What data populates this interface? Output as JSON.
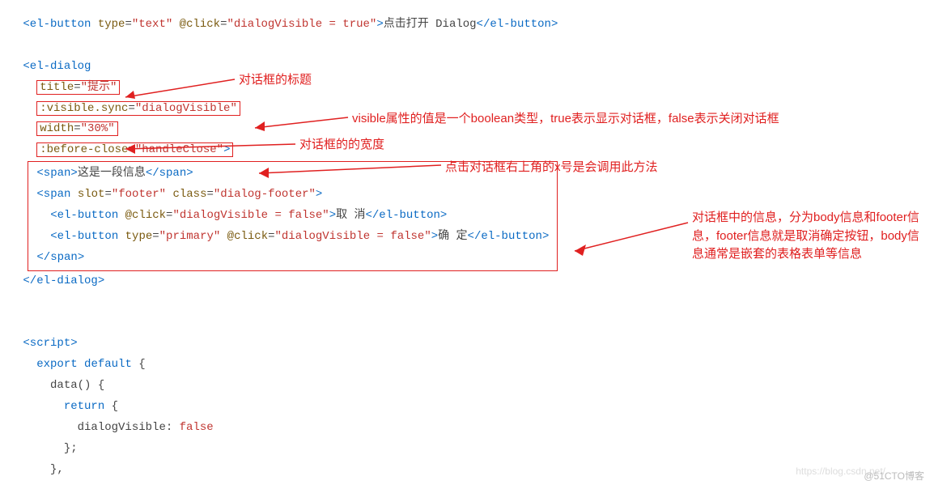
{
  "code": {
    "line1_open": "<el-button",
    "line1_attr1_name": " type",
    "line1_attr1_eq": "=",
    "line1_attr1_val": "\"text\"",
    "line1_attr2_name": " @click",
    "line1_attr2_eq": "=",
    "line1_attr2_val": "\"dialogVisible = true\"",
    "line1_close": ">",
    "line1_text": "点击打开 Dialog",
    "line1_end": "</el-button>",
    "dlg_open": "<el-dialog",
    "title_attr": "title",
    "title_eq": "=",
    "title_val": "\"提示\"",
    "visible_attr": ":visible.sync",
    "visible_eq": "=",
    "visible_val": "\"dialogVisible\"",
    "width_attr": "width",
    "width_eq": "=",
    "width_val": "\"30%\"",
    "before_attr": ":before-close",
    "before_eq": "=",
    "before_val": "\"handleClose\"",
    "before_close": ">",
    "span_open": "<span>",
    "span_text": "这是一段信息",
    "span_close": "</span>",
    "footer_open": "<span",
    "footer_slot_name": " slot",
    "footer_slot_eq": "=",
    "footer_slot_val": "\"footer\"",
    "footer_class_name": " class",
    "footer_class_eq": "=",
    "footer_class_val": "\"dialog-footer\"",
    "footer_gt": ">",
    "cancel_open": "<el-button",
    "cancel_click_name": " @click",
    "cancel_click_eq": "=",
    "cancel_click_val": "\"dialogVisible = false\"",
    "cancel_gt": ">",
    "cancel_text": "取 消",
    "cancel_close": "</el-button>",
    "confirm_open": "<el-button",
    "confirm_type_name": " type",
    "confirm_type_eq": "=",
    "confirm_type_val": "\"primary\"",
    "confirm_click_name": " @click",
    "confirm_click_eq": "=",
    "confirm_click_val": "\"dialogVisible = false\"",
    "confirm_gt": ">",
    "confirm_text": "确 定",
    "confirm_close": "</el-button>",
    "footer_end": "</span>",
    "dlg_end": "</el-dialog>",
    "script_open": "<script>",
    "export": "export",
    "default": " default",
    "brace_open": " {",
    "data_fn": "data() {",
    "return": "return",
    "return_brace": " {",
    "dv_key": "dialogVisible: ",
    "dv_val": "false",
    "closebrace_semi": "};",
    "closebrace_comma": "},"
  },
  "annotations": {
    "title": "对话框的标题",
    "visible": "visible属性的值是一个boolean类型，true表示显示对话框，false表示关闭对话框",
    "width": "对话框的的宽度",
    "beforeClose": "点击对话框右上角的x号是会调用此方法",
    "body": "对话框中的信息，分为body信息和footer信息，footer信息就是取消确定按钮，body信息通常是嵌套的表格表单等信息"
  },
  "watermark1": "https://blog.csdn.net/",
  "watermark2": "@51CTO博客"
}
